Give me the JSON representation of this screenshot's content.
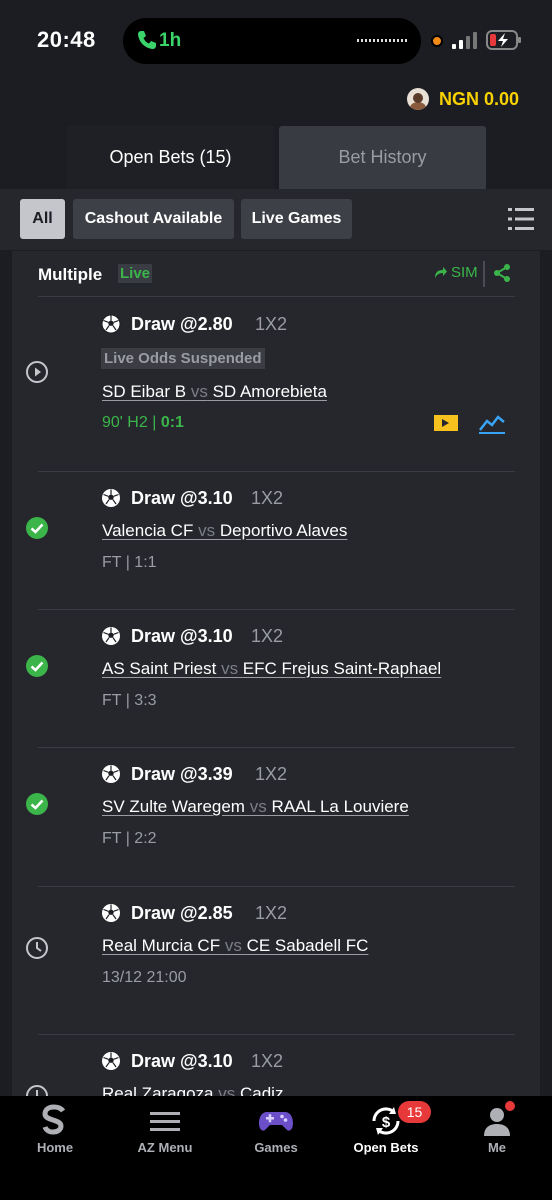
{
  "status_bar": {
    "time": "20:48",
    "call_duration": "1h"
  },
  "account": {
    "balance": "NGN 0.00",
    "accent_color": "#f7d100"
  },
  "tabs": [
    {
      "label": "Open Bets (15)",
      "active": true
    },
    {
      "label": "Bet History",
      "active": false
    }
  ],
  "filters": [
    {
      "label": "All",
      "selected": true
    },
    {
      "label": "Cashout Available",
      "selected": false
    },
    {
      "label": "Live Games",
      "selected": false
    }
  ],
  "card": {
    "title": "Multiple",
    "live_tag": "Live",
    "sim_label": "SIM"
  },
  "bets": [
    {
      "status": "live-play-icon",
      "pick": "Draw @2.80",
      "market": "1X2",
      "suspended_label": "Live Odds Suspended",
      "home": "SD Eibar B",
      "vs": "vs",
      "away": "SD Amorebieta",
      "time_label": "90' H2 |",
      "score": "0:1"
    },
    {
      "status": "won-check-icon",
      "pick": "Draw @3.10",
      "market": "1X2",
      "home": "Valencia CF",
      "vs": "vs",
      "away": "Deportivo Alaves",
      "result": "FT | 1:1"
    },
    {
      "status": "won-check-icon",
      "pick": "Draw @3.10",
      "market": "1X2",
      "home": "AS Saint Priest",
      "vs": "vs",
      "away": "EFC Frejus Saint-Raphael",
      "result": "FT | 3:3"
    },
    {
      "status": "won-check-icon",
      "pick": "Draw @3.39",
      "market": "1X2",
      "home": "SV Zulte Waregem",
      "vs": "vs",
      "away": "RAAL La Louviere",
      "result": "FT | 2:2"
    },
    {
      "status": "pending-clock-icon",
      "pick": "Draw @2.85",
      "market": "1X2",
      "home": "Real Murcia CF",
      "vs": "vs",
      "away": "CE Sabadell FC",
      "result": "13/12 21:00"
    },
    {
      "status": "pending-clock-icon",
      "pick": "Draw @3.10",
      "market": "1X2",
      "home": "Real Zaragoza",
      "vs": "vs",
      "away": "Cadiz"
    }
  ],
  "bottom_nav": [
    {
      "label": "Home",
      "icon": "sporty-logo-icon"
    },
    {
      "label": "AZ Menu",
      "icon": "menu-icon"
    },
    {
      "label": "Games",
      "icon": "gamepad-icon"
    },
    {
      "label": "Open Bets",
      "icon": "open-bets-icon",
      "badge": "15",
      "active": true
    },
    {
      "label": "Me",
      "icon": "user-icon"
    }
  ],
  "colors": {
    "background": "#1b1d23",
    "card": "#25272d",
    "live_green": "#3bb54a",
    "badge_red": "#e8393a"
  }
}
